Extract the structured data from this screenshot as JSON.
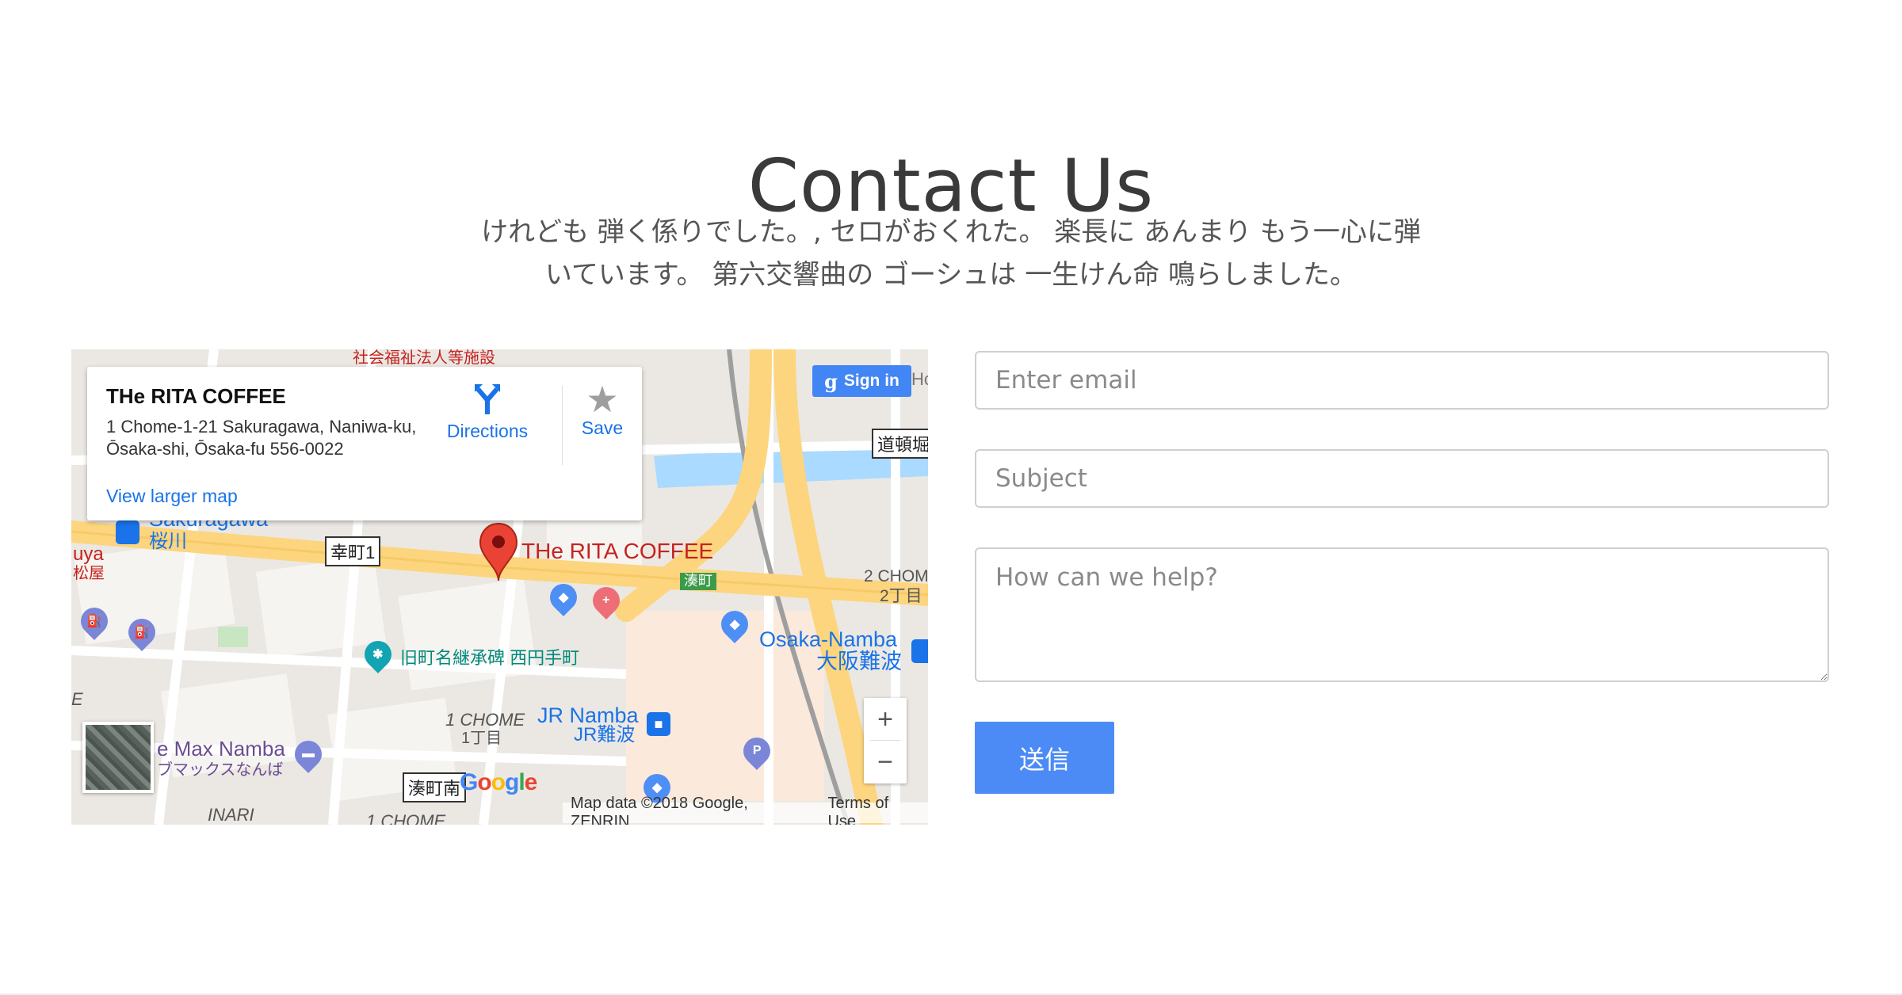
{
  "contact": {
    "title": "Contact Us",
    "lead_line1": "けれども 弾く係りでした。, セロがおくれた。 楽長に あんまり もう一心に弾",
    "lead_line2": "いています。 第六交響曲の ゴーシュは 一生けん命 鳴らしました。"
  },
  "map": {
    "place_name": "THe RITA COFFEE",
    "address": "1 Chome-1-21 Sakuragawa, Naniwa-ku, Ōsaka-shi, Ōsaka-fu 556-0022",
    "directions_label": "Directions",
    "save_label": "Save",
    "view_larger_label": "View larger map",
    "sign_in_label": "Sign in",
    "marker_label": "THe RITA COFFEE",
    "attribution": "Map data ©2018 Google, ZENRIN",
    "terms": "Terms of Use",
    "google_logo": "Google",
    "labels": {
      "sakuragawa": "Sakuragawa",
      "sakuragawa_jp": "桜川",
      "uya": "uya",
      "matsuya_jp": "松屋",
      "kouchou1": "幸町1",
      "minatomachi_jp": "湊町",
      "osaka_namba": "Osaka-Namba",
      "osaka_namba_jp": "大阪難波",
      "kyuchou": "旧町名継承碑 西円手町",
      "jr_namba": "JR Namba",
      "jr_namba_jp": "JR難波",
      "one_chome": "1 CHOME",
      "one_chome_jp": "1丁目",
      "two_chome": "2 CHOME",
      "two_chome_jp": "2丁目",
      "max_namba": "e Max Namba",
      "max_namba_jp": "ブマックスなんば",
      "minatomachi_minami": "湊町南",
      "dotonbori": "道頓堀",
      "inari": "INARI",
      "one_chome_bottom": "1 CHOME",
      "e_left": "E",
      "hc": "Hc",
      "top_red": "社会福祉法人等施設"
    }
  },
  "form": {
    "email_placeholder": "Enter email",
    "subject_placeholder": "Subject",
    "message_placeholder": "How can we help?",
    "submit_label": "送信"
  },
  "colors": {
    "accent": "#4c8bf5",
    "marker": "#ea4335",
    "highway": "#fcd57e",
    "water": "#aadaff"
  }
}
